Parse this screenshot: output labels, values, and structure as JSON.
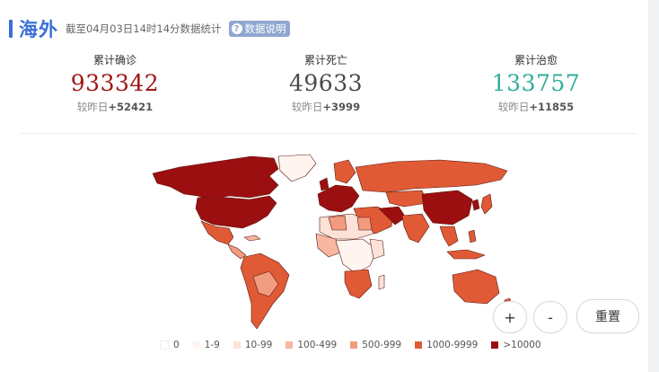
{
  "header": {
    "title": "海外",
    "update_time": "截至04月03日14时14分数据统计",
    "info_label": "数据说明",
    "info_icon": "question-circle-icon"
  },
  "stats": [
    {
      "label": "累计确诊",
      "value": "933342",
      "delta_prefix": "较昨日",
      "delta_value": "+52421",
      "color": "#a01515"
    },
    {
      "label": "累计死亡",
      "value": "49633",
      "delta_prefix": "较昨日",
      "delta_value": "+3999",
      "color": "#4a4a4a"
    },
    {
      "label": "累计治愈",
      "value": "133757",
      "delta_prefix": "较昨日",
      "delta_value": "+11855",
      "color": "#2fae9a"
    }
  ],
  "map_controls": {
    "zoom_in": "+",
    "zoom_out": "-",
    "reset": "重置"
  },
  "legend": [
    {
      "label": "0",
      "color": "#ffffff"
    },
    {
      "label": "1-9",
      "color": "#fff4ef"
    },
    {
      "label": "10-99",
      "color": "#fde2d8"
    },
    {
      "label": "100-499",
      "color": "#f7b7a0"
    },
    {
      "label": "500-999",
      "color": "#f19c7f"
    },
    {
      "label": "1000-9999",
      "color": "#e05a36"
    },
    {
      "label": ">10000",
      "color": "#9b0f10"
    }
  ]
}
